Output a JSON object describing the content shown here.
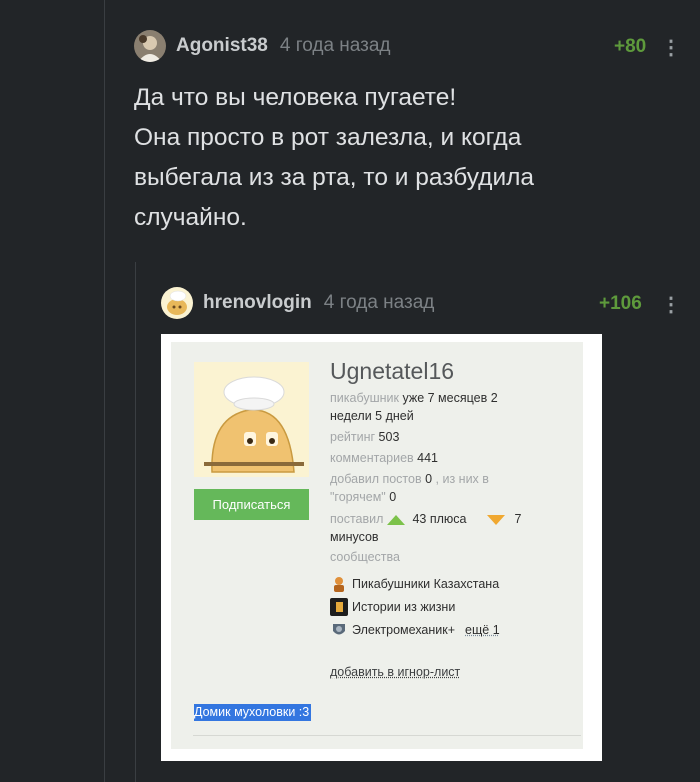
{
  "comment": {
    "username": "Agonist38",
    "time": "4 года назад",
    "rating": "+80",
    "more": "⋮",
    "text_lines": [
      "Да что вы человека пугаете!",
      "Она просто в рот залезла, и когда",
      "выбегала из за рта, то и разбудила",
      "случайно."
    ]
  },
  "reply": {
    "username": "hrenovlogin",
    "time": "4 года назад",
    "rating": "+106",
    "more": "⋮"
  },
  "profile": {
    "name": "Ugnetatel16",
    "subscribe_label": "Подписаться",
    "pikabu_label": "пикабушник",
    "pikabu_value_1": "уже 7 месяцев 2",
    "pikabu_value_2": "недели 5 дней",
    "rating_label": "рейтинг",
    "rating_value": "503",
    "comments_label": "комментариев",
    "comments_value": "441",
    "posts_label": "добавил постов",
    "posts_value": "0",
    "posts_mid": ", из них в",
    "hot_label": "\"горячем\"",
    "hot_value": "0",
    "voted_label": "поставил",
    "plus_value": "43 плюса",
    "minus_value": "7",
    "minus_label": "минусов",
    "communities_label": "сообщества",
    "communities": [
      "Пикабушники Казахстана",
      "Истории из жизни",
      "Электромеханик+"
    ],
    "more_communities": "ещё 1",
    "ignore_label": "добавить в игнор-лист",
    "note": "Домик мухоловки :3"
  },
  "colors": {
    "background": "#222528",
    "rating_green": "#5e9a3c",
    "subscribe_green": "#65b85a",
    "selection_blue": "#3376e0"
  }
}
